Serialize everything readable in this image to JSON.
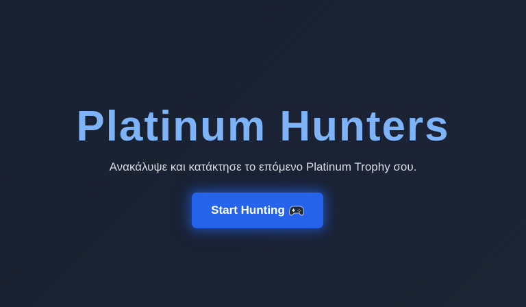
{
  "hero": {
    "title": "Platinum Hunters",
    "subtitle": "Ανακάλυψε και κατάκτησε το επόμενο Platinum Trophy σου.",
    "cta": {
      "label": "Start Hunting",
      "icon": "gamepad-icon"
    }
  },
  "colors": {
    "background": "#1a2233",
    "title": "#7fb3f7",
    "subtitle": "#d7dbe2",
    "button": "#2563eb",
    "button_text": "#ffffff"
  }
}
